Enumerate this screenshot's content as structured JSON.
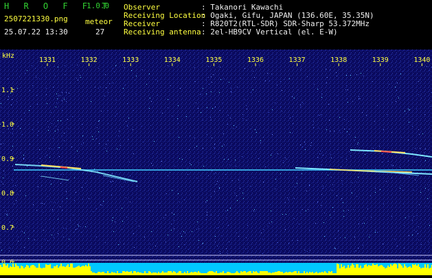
{
  "header": {
    "app_name": "H R O F F T",
    "version": "1.0.0",
    "filename": "2507221330.png",
    "datetime": "25.07.22 13:30",
    "meteor_label": "meteor",
    "meteor_count": "27",
    "observer_label": "Observer",
    "observer_value": ": Takanori Kawachi",
    "location_label": "Receiving Location",
    "location_value": ": Ogaki, Gifu, JAPAN (136.60E, 35.35N)",
    "receiver_label": "Receiver",
    "receiver_value": ": R820T2(RTL-SDR) SDR-Sharp 53.372MHz",
    "antenna_label": "Receiving antenna",
    "antenna_value": ": 2el-HB9CV Vertical (el. E-W)"
  },
  "axis": {
    "y_unit": "kHz",
    "time_ticks": [
      "1331",
      "1332",
      "1333",
      "1334",
      "1335",
      "1336",
      "1337",
      "1338",
      "1339",
      "1340"
    ],
    "freq_ticks": [
      "1.1",
      "1.0",
      "0.9",
      "0.8",
      "0.7",
      "0.6"
    ]
  },
  "colors": {
    "background": "#0a0a5a",
    "carrier": "#4ad0ff",
    "tick_text": "#ffff40",
    "power_bar": "#ffff00",
    "power_base": "#00c8ff"
  }
}
